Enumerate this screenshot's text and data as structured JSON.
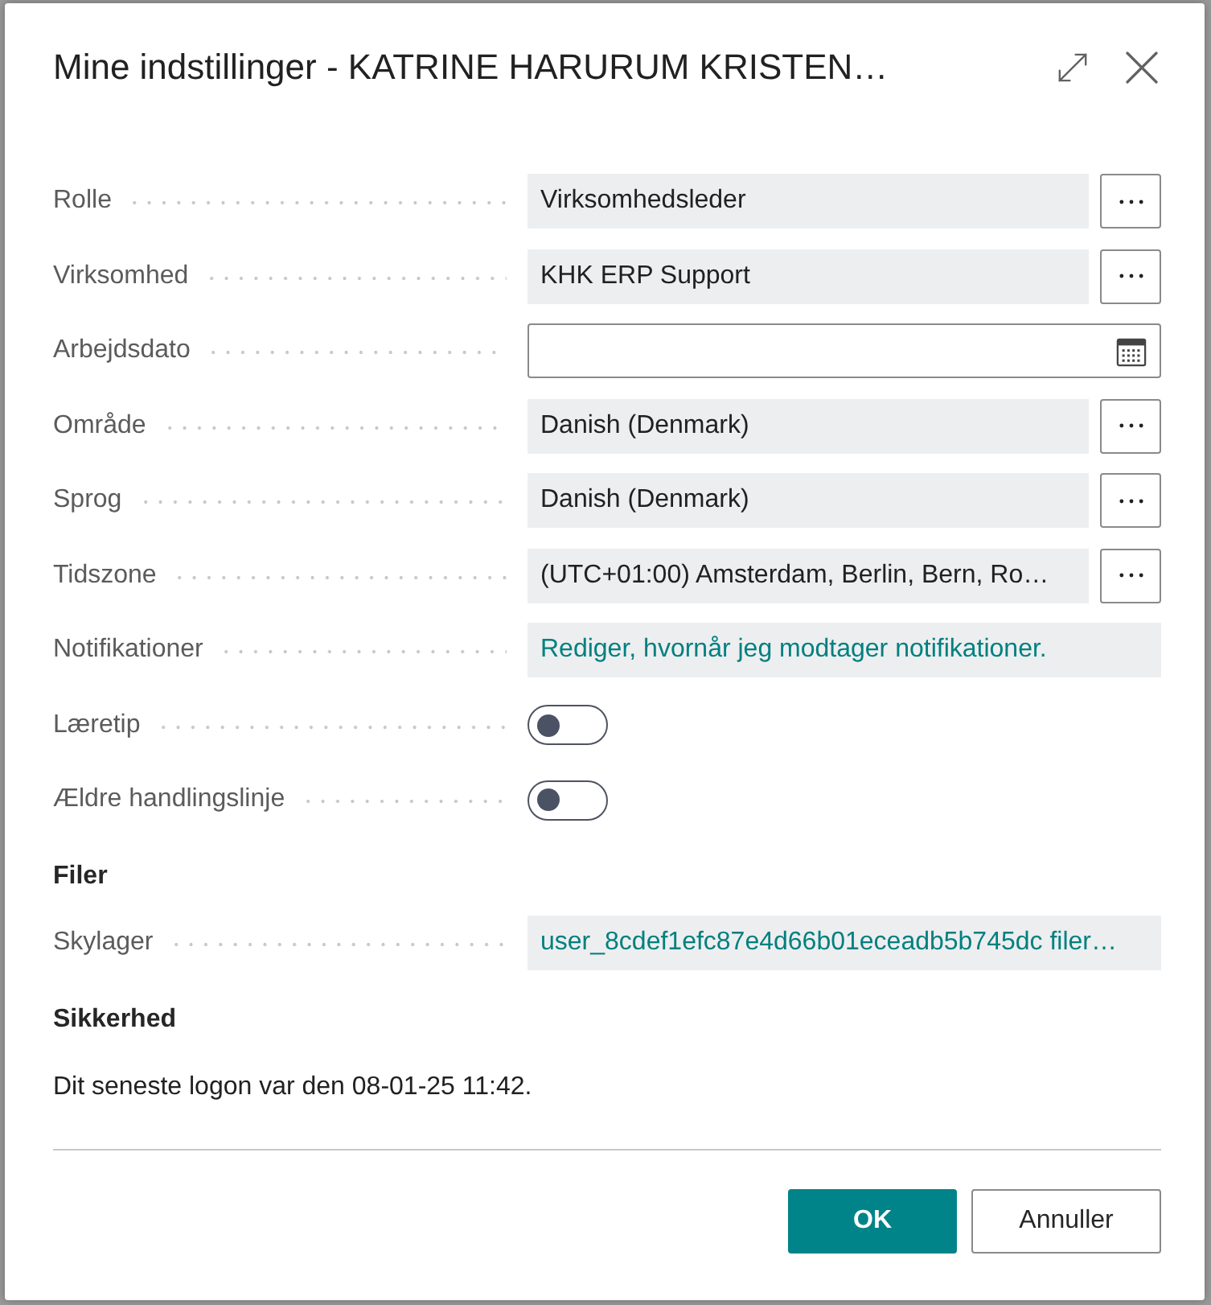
{
  "dialog": {
    "title": "Mine indstillinger - KATRINE HARURUM KRISTEN…"
  },
  "groups": [
    {
      "fields": [
        {
          "label": "Rolle",
          "kind": "lookup",
          "value": "Virksomhedsleder"
        },
        {
          "label": "Virksomhed",
          "kind": "lookup",
          "value": "KHK ERP Support"
        },
        {
          "label": "Arbejdsdato",
          "kind": "date"
        },
        {
          "label": "Område",
          "kind": "lookup",
          "value": "Danish (Denmark)"
        },
        {
          "label": "Sprog",
          "kind": "lookup",
          "value": "Danish (Denmark)"
        },
        {
          "label": "Tidszone",
          "kind": "lookup",
          "value": "(UTC+01:00) Amsterdam, Berlin, Bern, Ro…"
        },
        {
          "label": "Notifikationer",
          "kind": "link",
          "value": "Rediger, hvornår jeg modtager notifikationer."
        },
        {
          "label": "Læretip",
          "kind": "toggle",
          "on": false
        },
        {
          "label": "Ældre handlingslinje",
          "kind": "toggle",
          "on": false
        }
      ]
    },
    {
      "heading": "Filer",
      "fields": [
        {
          "label": "Skylager",
          "kind": "link",
          "value": "user_8cdef1efc87e4d66b01eceadb5b745dc filer…"
        }
      ]
    },
    {
      "heading": "Sikkerhed",
      "text": "Dit seneste logon var den 08-01-25 11:42."
    }
  ],
  "buttons": [
    {
      "label": "OK",
      "kind": "primary"
    },
    {
      "label": "Annuller",
      "kind": "secondary"
    }
  ]
}
